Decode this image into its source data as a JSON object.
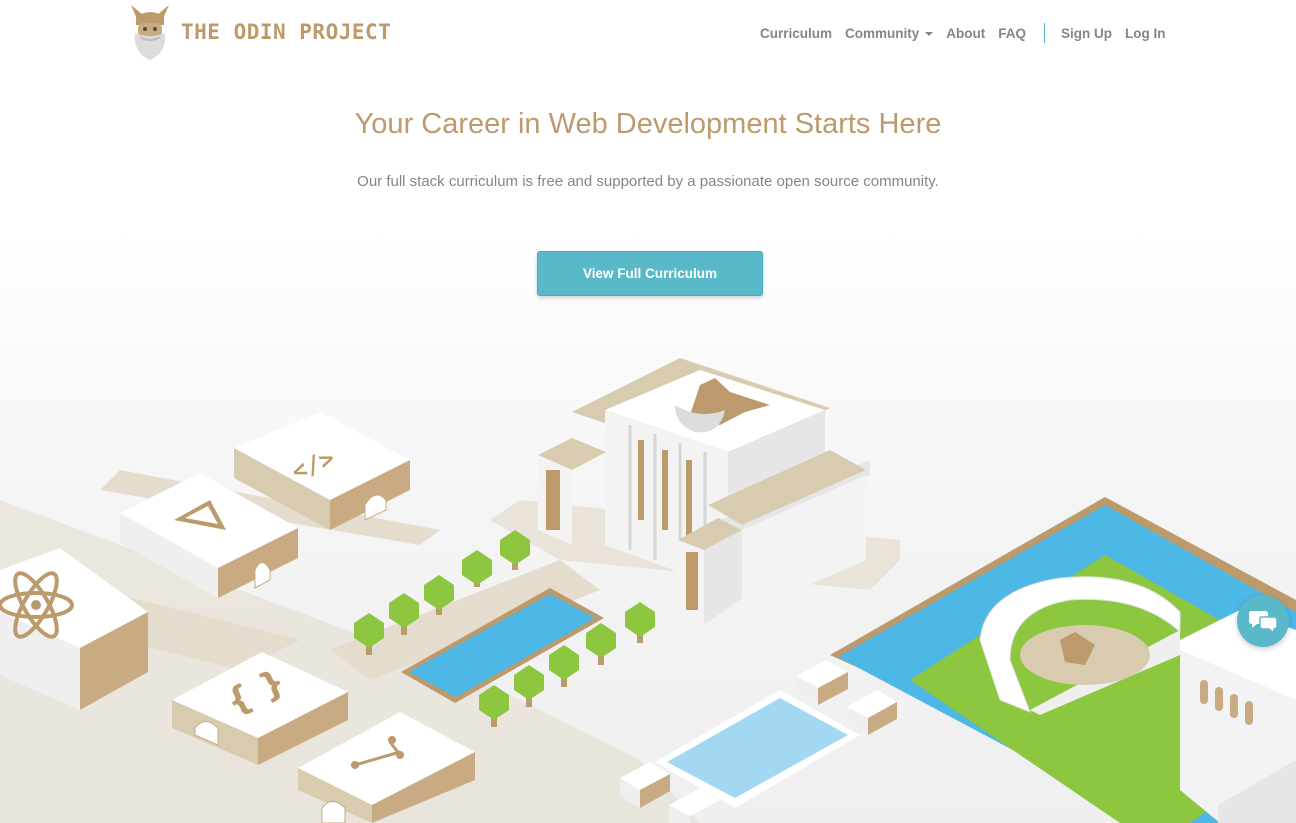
{
  "brand": {
    "name": "THE ODIN PROJECT",
    "logo_icon": "odin-viking-head-icon"
  },
  "nav": {
    "items": [
      {
        "label": "Curriculum"
      },
      {
        "label": "Community",
        "has_dropdown": true
      },
      {
        "label": "About"
      },
      {
        "label": "FAQ"
      }
    ],
    "auth": [
      {
        "label": "Sign Up"
      },
      {
        "label": "Log In"
      }
    ]
  },
  "hero": {
    "title": "Your Career in Web Development Starts Here",
    "subtitle": "Our full stack curriculum is free and supported by a passionate open source community.",
    "cta_label": "View Full Curriculum"
  },
  "illustration": {
    "icons": [
      "react-atom-icon",
      "html-tag-icon",
      "angular-icon",
      "curly-braces-icon",
      "git-branch-icon",
      "odin-head-icon"
    ]
  },
  "chat_widget": {
    "icon": "chat-bubbles-icon"
  },
  "colors": {
    "accent": "#5ab9c9",
    "brand": "#bc9a6c",
    "text_muted": "#85877f",
    "water": "#4db7e6",
    "grass": "#8dc63f"
  }
}
